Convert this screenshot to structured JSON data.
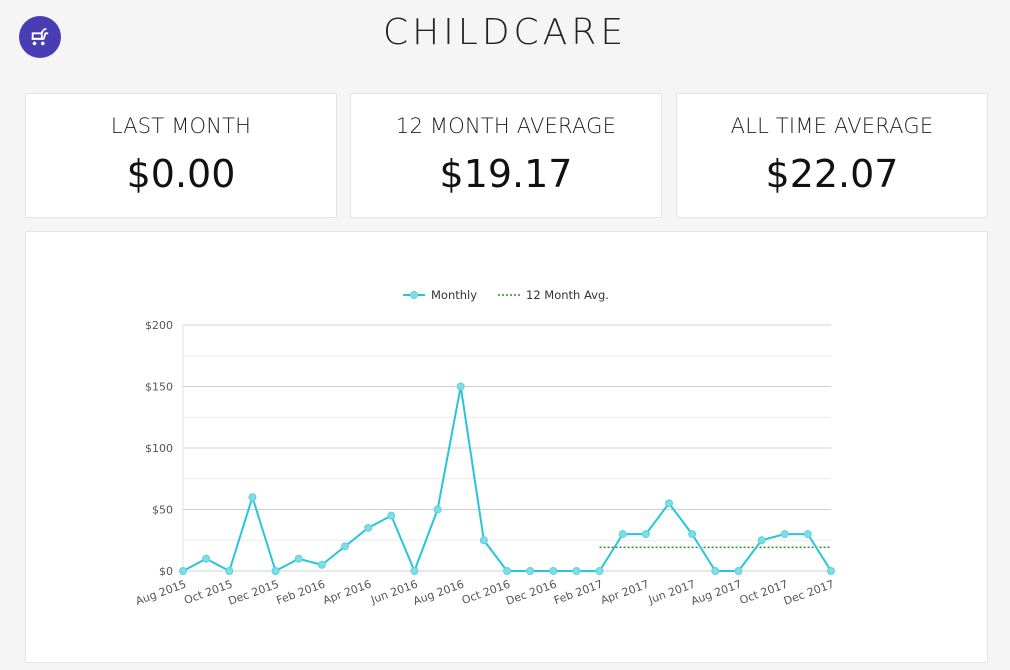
{
  "header": {
    "title": "CHILDCARE",
    "icon": "stroller-icon",
    "accent": "#4a3db4"
  },
  "stats": [
    {
      "label": "LAST MONTH",
      "value": "$0.00"
    },
    {
      "label": "12 MONTH AVERAGE",
      "value": "$19.17"
    },
    {
      "label": "ALL TIME AVERAGE",
      "value": "$22.07"
    }
  ],
  "chart_data": {
    "type": "line",
    "title": "",
    "xlabel": "",
    "ylabel": "",
    "ylim": [
      0,
      200
    ],
    "yticks": [
      0,
      50,
      100,
      150,
      200
    ],
    "ytick_labels": [
      "$0",
      "$50",
      "$100",
      "$150",
      "$200"
    ],
    "grid": true,
    "legend_position": "top-center",
    "x": [
      "Aug 2015",
      "Sep 2015",
      "Oct 2015",
      "Nov 2015",
      "Dec 2015",
      "Jan 2016",
      "Feb 2016",
      "Mar 2016",
      "Apr 2016",
      "May 2016",
      "Jun 2016",
      "Jul 2016",
      "Aug 2016",
      "Sep 2016",
      "Oct 2016",
      "Nov 2016",
      "Dec 2016",
      "Jan 2017",
      "Feb 2017",
      "Mar 2017",
      "Apr 2017",
      "May 2017",
      "Jun 2017",
      "Jul 2017",
      "Aug 2017",
      "Sep 2017",
      "Oct 2017",
      "Nov 2017",
      "Dec 2017"
    ],
    "x_tick_labels": [
      "Aug 2015",
      "Oct 2015",
      "Dec 2015",
      "Feb 2016",
      "Apr 2016",
      "Jun 2016",
      "Aug 2016",
      "Oct 2016",
      "Dec 2016",
      "Feb 2017",
      "Apr 2017",
      "Jun 2017",
      "Aug 2017",
      "Oct 2017",
      "Dec 2017"
    ],
    "series": [
      {
        "name": "Monthly",
        "color": "#26c6da",
        "style": "solid",
        "values": [
          0,
          10,
          0,
          60,
          0,
          10,
          5,
          20,
          35,
          45,
          0,
          50,
          150,
          25,
          0,
          0,
          0,
          0,
          0,
          30,
          30,
          55,
          30,
          0,
          0,
          25,
          30,
          30,
          0
        ]
      },
      {
        "name": "12 Month Avg.",
        "color": "#2e8b2e",
        "style": "dotted",
        "start": "Feb 2017",
        "end": "Dec 2017",
        "value": 19.17
      }
    ]
  }
}
